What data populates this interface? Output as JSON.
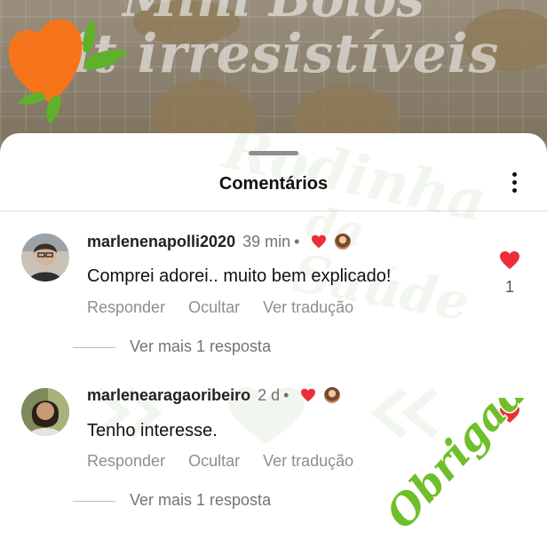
{
  "post": {
    "title_line1": "Mini Bolos",
    "title_line2": "fit irresistíveis"
  },
  "watermark": {
    "line1": "Rodinha",
    "line2": "da",
    "line3": "Saúde"
  },
  "sheet": {
    "title": "Comentários"
  },
  "comments": [
    {
      "username": "marlenenapolli2020",
      "time": "39 min",
      "text": "Comprei adorei.. muito bem explicado!",
      "reply_label": "Responder",
      "hide_label": "Ocultar",
      "translate_label": "Ver tradução",
      "more_replies": "Ver mais 1 resposta",
      "likes": "1"
    },
    {
      "username": "marlenearagaoribeiro",
      "time": "2 d",
      "text": "Tenho interesse.",
      "reply_label": "Responder",
      "hide_label": "Ocultar",
      "translate_label": "Ver tradução",
      "more_replies": "Ver mais 1 resposta"
    }
  ],
  "sticker": {
    "text": "Obrigada!"
  },
  "colors": {
    "heart": "#ed2e3a",
    "logo_orange": "#f7751a",
    "logo_green": "#5fb12a",
    "sticker_green": "#6fbf2a"
  },
  "icons": {
    "more": "more-vertical-icon",
    "heart": "heart-icon",
    "logo": "heart-leaf-logo-icon"
  }
}
